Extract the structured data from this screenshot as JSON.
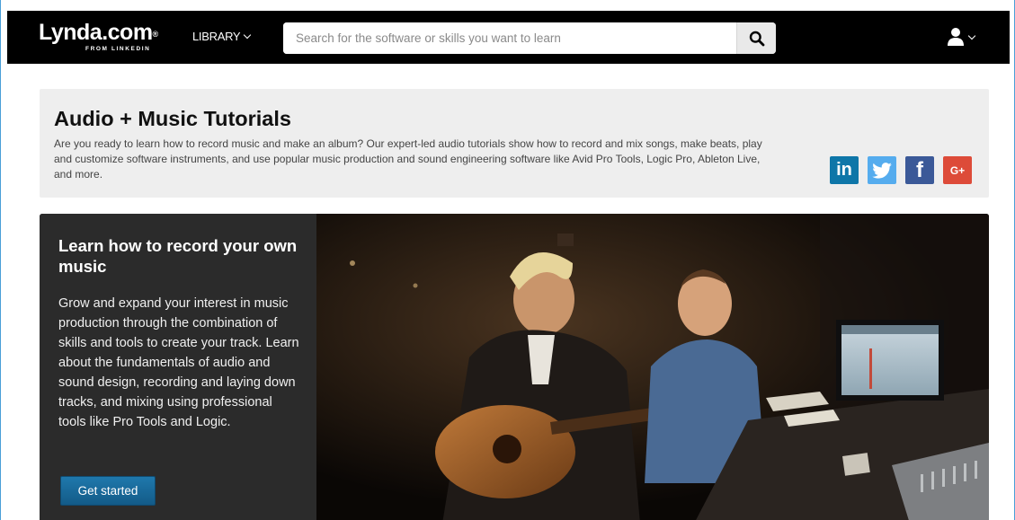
{
  "nav": {
    "logo_text": "Lynda.com",
    "logo_mark": "®",
    "logo_sub": "FROM LINKEDIN",
    "library_label": "LIBRARY",
    "search_placeholder": "Search for the software or skills you want to learn",
    "search_icon": "search-icon",
    "user_icon": "user-icon"
  },
  "header": {
    "title": "Audio + Music Tutorials",
    "description": "Are you ready to learn how to record music and make an album? Our expert-led audio tutorials show how to record and mix songs, make beats, play and customize software instruments, and use popular music production and sound engineering software like Avid Pro Tools, Logic Pro, Ableton Live, and more.",
    "social": [
      {
        "name": "linkedin",
        "glyph": "in",
        "color": "#0e76a8"
      },
      {
        "name": "twitter",
        "glyph": "",
        "color": "#55acee"
      },
      {
        "name": "facebook",
        "glyph": "f",
        "color": "#3b5998"
      },
      {
        "name": "google-plus",
        "glyph": "G+",
        "color": "#dd4b39"
      }
    ]
  },
  "hero": {
    "title": "Learn how to record your own music",
    "body": "Grow and expand your interest in music production through the combination of skills and tools to create your track. Learn about the fundamentals of audio and sound design, recording and laying down tracks, and mixing using professional tools like Pro Tools and Logic.",
    "cta_label": "Get started"
  },
  "colors": {
    "nav_bg": "#000000",
    "panel_bg": "#eeeeee",
    "cta": "#1a6a9c",
    "hero_panel": "#2b2b2b"
  }
}
